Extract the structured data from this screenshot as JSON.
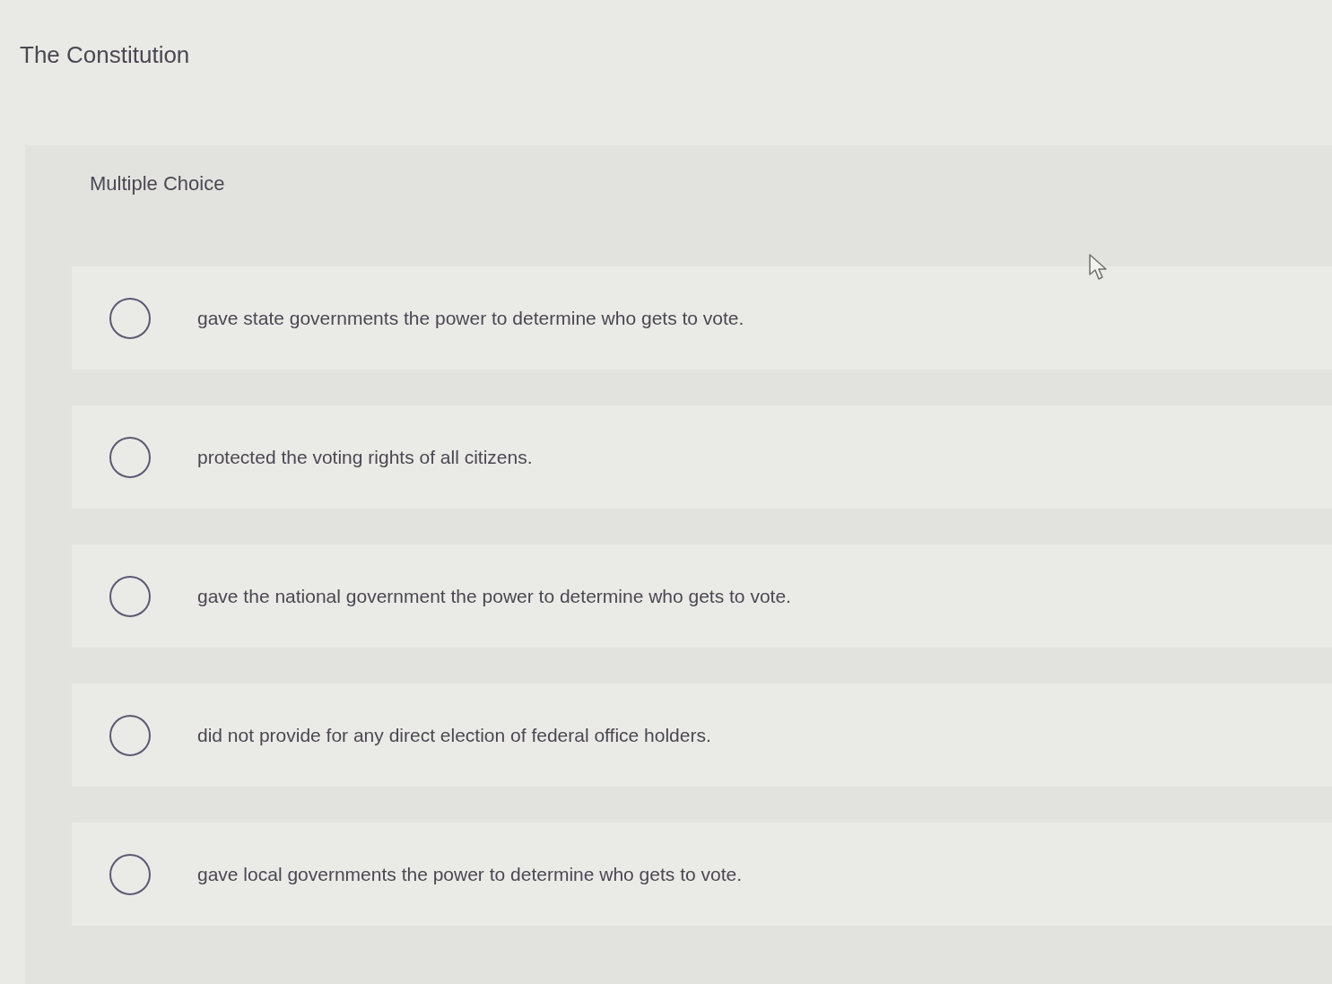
{
  "page": {
    "title": "The Constitution"
  },
  "question": {
    "type_label": "Multiple Choice",
    "options": [
      {
        "text": "gave state governments the power to determine who gets to vote.",
        "selected": false
      },
      {
        "text": "protected the voting rights of all citizens.",
        "selected": false
      },
      {
        "text": "gave the national government the power to determine who gets to vote.",
        "selected": false
      },
      {
        "text": "did not provide for any direct election of federal office holders.",
        "selected": false
      },
      {
        "text": "gave local governments the power to determine who gets to vote.",
        "selected": false
      }
    ]
  }
}
